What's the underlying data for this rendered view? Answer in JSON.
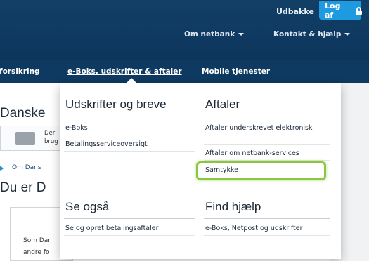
{
  "header": {
    "user_name": "Udbakke",
    "logoff_label": "Log af",
    "nav": {
      "om_netbank": "Om netbank",
      "kontakt": "Kontakt & hjælp"
    }
  },
  "menubar": {
    "items": [
      "forsikring",
      "e-Boks, udskrifter & aftaler",
      "Mobile tjenester"
    ]
  },
  "background": {
    "title_1": "Danske",
    "promo_line_1": "Der",
    "promo_line_2": "brug",
    "link": "Om Dans",
    "title_2": "Du er D",
    "body_line_1": "Som Dar",
    "body_line_2": "andre fo"
  },
  "dropdown": {
    "udskrifter": {
      "title": "Udskrifter og breve",
      "links": [
        "e-Boks",
        "Betalingsserviceoversigt"
      ]
    },
    "aftaler": {
      "title": "Aftaler",
      "links": [
        "Aftaler underskrevet elektronisk",
        "Aftaler om netbank-services",
        "Samtykke"
      ]
    },
    "se_ogsaa": {
      "title": "Se også",
      "links": [
        "Se og opret betalingsaftaler"
      ]
    },
    "find_hjaelp": {
      "title": "Find hjælp",
      "links": [
        "e-Boks, Netpost og udskrifter"
      ]
    }
  },
  "colors": {
    "header_bg": "#0f3a62",
    "logoff_bg": "#1e9be0",
    "highlight": "#8cc63f"
  }
}
